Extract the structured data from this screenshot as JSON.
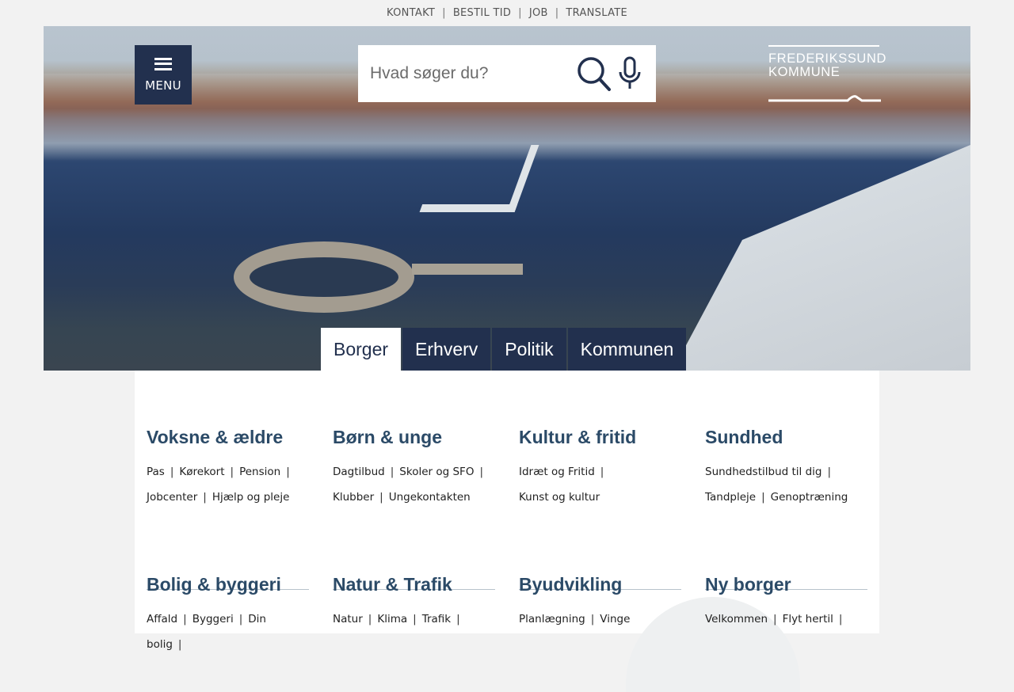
{
  "topbar": {
    "links": [
      "KONTAKT",
      "BESTIL TID",
      "JOB",
      "TRANSLATE"
    ],
    "separator": "|"
  },
  "menu": {
    "label": "MENU",
    "icon": "hamburger-icon"
  },
  "search": {
    "placeholder": "Hvad søger du?",
    "value": "",
    "search_icon": "search-icon",
    "mic_icon": "microphone-icon"
  },
  "logo": {
    "line1": "FREDERIKSSUND",
    "line2": "KOMMUNE"
  },
  "tabs": [
    {
      "label": "Borger",
      "active": true
    },
    {
      "label": "Erhverv",
      "active": false
    },
    {
      "label": "Politik",
      "active": false
    },
    {
      "label": "Kommunen",
      "active": false
    }
  ],
  "categories": [
    {
      "title": "Voksne & ældre",
      "links": [
        "Pas",
        "Kørekort",
        "Pension",
        "Jobcenter",
        "Hjælp og pleje"
      ]
    },
    {
      "title": "Børn & unge",
      "links": [
        "Dagtilbud",
        "Skoler og SFO",
        "Klubber",
        "Ungekontakten"
      ]
    },
    {
      "title": "Kultur & fritid",
      "links": [
        "Idræt og Fritid",
        "Kunst og kultur"
      ]
    },
    {
      "title": "Sundhed",
      "links": [
        "Sundhedstilbud til dig",
        "Tandpleje",
        "Genoptræning"
      ]
    },
    {
      "title": "Bolig & byggeri",
      "links": [
        "Affald",
        "Byggeri",
        "Din bolig"
      ]
    },
    {
      "title": "Natur & Trafik",
      "links": [
        "Natur",
        "Klima",
        "Trafik"
      ]
    },
    {
      "title": "Byudvikling",
      "links": [
        "Planlægning",
        "Vinge"
      ]
    },
    {
      "title": "Ny borger",
      "links": [
        "Velkommen",
        "Flyt hertil"
      ]
    }
  ],
  "colors": {
    "navy": "#22304e",
    "heading": "#2b4a67",
    "page_bg": "#f2f2f2"
  }
}
